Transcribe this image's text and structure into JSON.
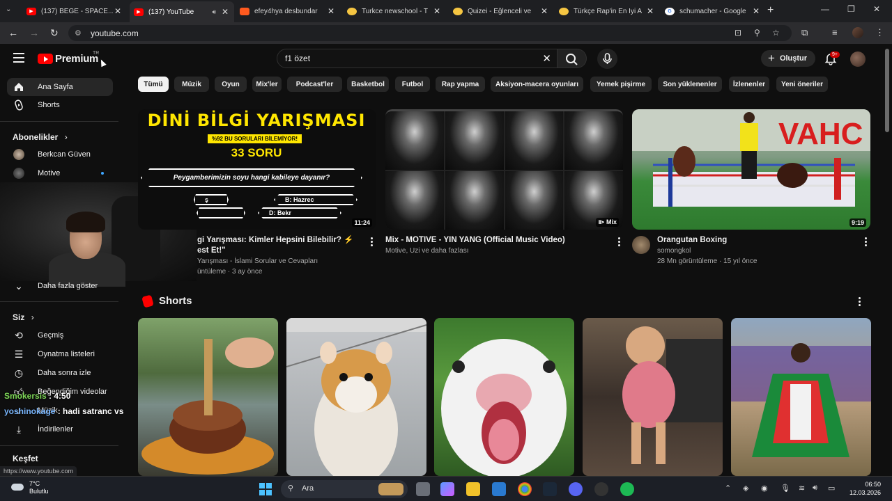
{
  "browser": {
    "tabs": [
      {
        "label": "(137) BEGE - SPACE...",
        "color": "#ff0000"
      },
      {
        "label": "(137) YouTube",
        "color": "#ff0000"
      },
      {
        "label": "efey4hya desbundar",
        "color": "#ff5a1f"
      },
      {
        "label": "Turkce newschool - T",
        "color": "#f5c542"
      },
      {
        "label": "Quizei - Eğlenceli ve",
        "color": "#f5c542"
      },
      {
        "label": "Türkçe Rap'in En İyi A",
        "color": "#f5c542"
      },
      {
        "label": "schumacher - Google",
        "color": "#4285f4"
      }
    ],
    "url": "youtube.com"
  },
  "header": {
    "logo": "Premium",
    "country": "TR",
    "search_value": "f1 özet",
    "create_label": "Oluştur",
    "notif_count": "9+"
  },
  "sidebar": {
    "home": "Ana Sayfa",
    "shorts": "Shorts",
    "subs_header": "Abonelikler",
    "subs": [
      {
        "label": "Berkcan Güven"
      },
      {
        "label": "Motive"
      }
    ],
    "show_more": "Daha fazla göster",
    "you_header": "Siz",
    "you_items": [
      {
        "label": "Geçmiş",
        "icon": "history-icon"
      },
      {
        "label": "Oynatma listeleri",
        "icon": "playlist-icon"
      },
      {
        "label": "Daha sonra izle",
        "icon": "clock-icon"
      },
      {
        "label": "Beğendiğim videolar",
        "icon": "like-icon"
      },
      {
        "label": "Müzik",
        "icon": "music-icon"
      },
      {
        "label": "İndirilenler",
        "icon": "download-icon"
      }
    ],
    "explore_header": "Keşfet"
  },
  "overlays": {
    "line1_name": "Smokersis",
    "line1_text": ": 4:50",
    "line2_name": "yoshinokage",
    "line2_text": ": hadi satranc vs",
    "status_url": "https://www.youtube.com"
  },
  "chips": [
    "Tümü",
    "Müzik",
    "Oyun",
    "Mix'ler",
    "Podcast'ler",
    "Basketbol",
    "Futbol",
    "Rap yapma",
    "Aksiyon-macera oyunları",
    "Yemek pişirme",
    "Son yüklenenler",
    "İzlenenler",
    "Yeni öneriler"
  ],
  "videos": [
    {
      "title_line1": "gi Yarışması: Kimler Hepsini Bilebilir? ⚡",
      "title_line2": "est Et!\"",
      "meta1": "Yarışması - İslami Sorular ve Cevapları",
      "meta2": "üntüleme · 3 ay önce",
      "duration": "11:24",
      "thumb": {
        "title": "DİNİ BİLGİ YARIŞMASI",
        "banner": "%92 BU SORULARI BİLEMİYOR!",
        "count": "33 SORU",
        "question": "Peygamberimizin soyu hangi kabileye dayanır?",
        "answer_b": "B: Hazrec",
        "answer_d": "D: Bekr",
        "answer_c": "ş"
      }
    },
    {
      "title": "Mix - MOTIVE - YIN YANG (Official Music Video)",
      "meta1": "Motive, Uzi ve daha fazlası",
      "badge": "Mix"
    },
    {
      "title": "Orangutan Boxing",
      "channel": "somongkol",
      "meta": "28 Mn görüntüleme · 15 yıl önce",
      "duration": "9:19"
    }
  ],
  "shorts": {
    "title": "Shorts"
  },
  "taskbar": {
    "temp": "7°C",
    "weather": "Bulutlu",
    "search": "Ara",
    "time": "06:50",
    "date": "12.03.2026"
  }
}
